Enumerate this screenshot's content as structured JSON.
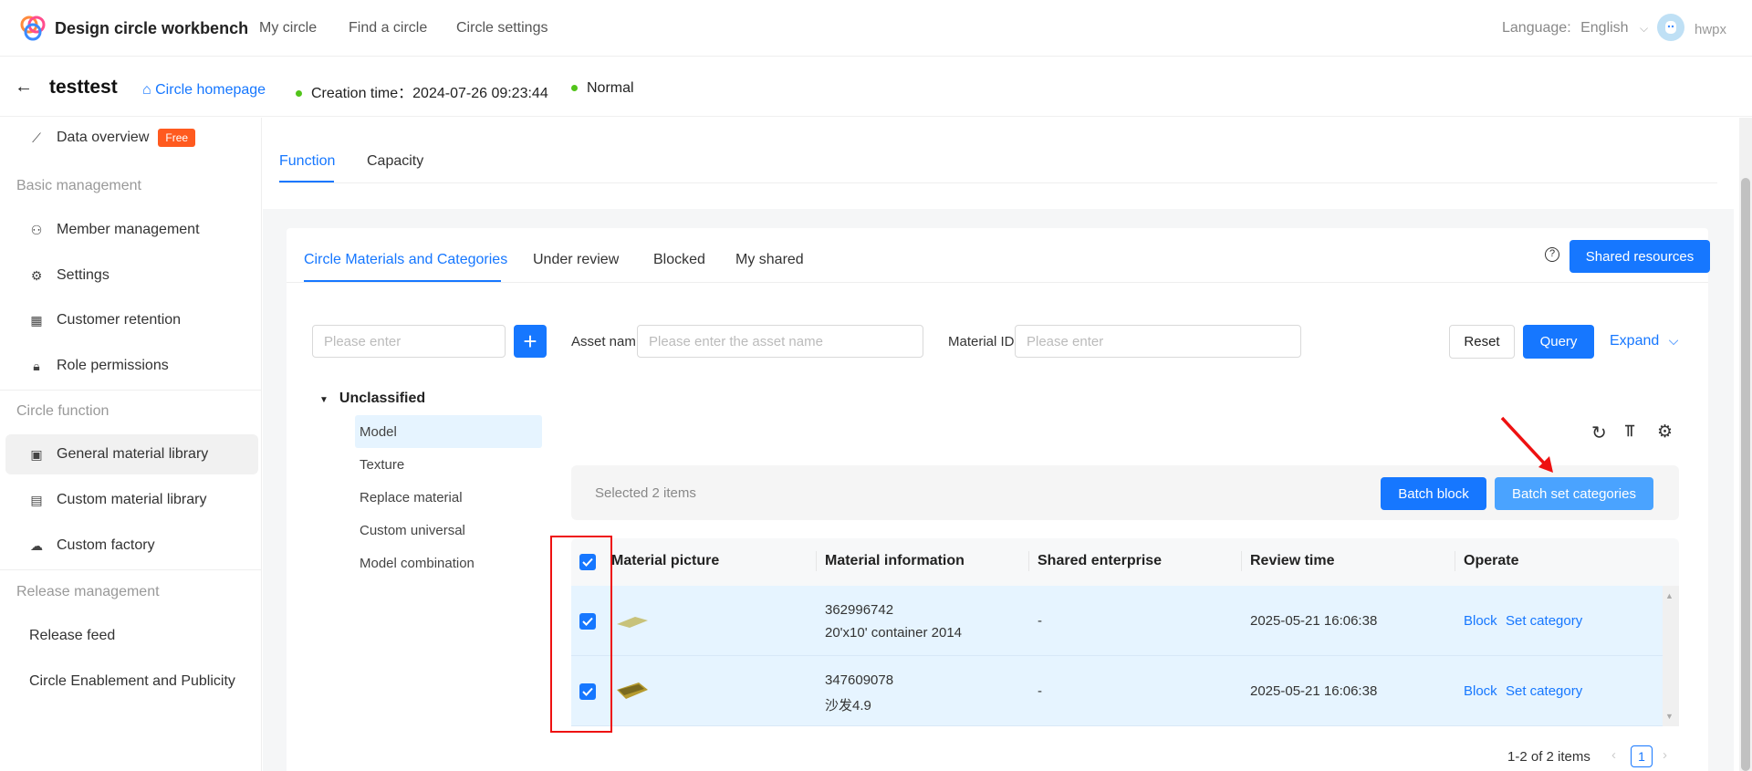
{
  "app": {
    "title": "Design circle workbench",
    "nav": [
      "My circle",
      "Find a circle",
      "Circle settings"
    ],
    "language_label": "Language:",
    "language_value": "English",
    "username": "hwpx"
  },
  "header": {
    "circle_name": "testtest",
    "home_link": "Circle homepage",
    "creation_time": "Creation time：2024-07-26 09:23:44",
    "status": "Normal"
  },
  "sidebar": {
    "data_overview": "Data overview",
    "free_badge": "Free",
    "groups": [
      "Basic management",
      "Circle function",
      "Release management"
    ],
    "basic": [
      "Member management",
      "Settings",
      "Customer retention",
      "Role permissions"
    ],
    "function": [
      "General material library",
      "Custom material library",
      "Custom factory"
    ],
    "release": [
      "Release feed",
      "Circle Enablement and Publicity"
    ]
  },
  "main": {
    "tabs": [
      "Function",
      "Capacity"
    ],
    "subtabs": [
      "Circle Materials and Categories",
      "Under review",
      "Blocked",
      "My shared"
    ],
    "shared_resources": "Shared resources",
    "filters": {
      "category_placeholder": "Please enter",
      "asset_label": "Asset nam",
      "asset_placeholder": "Please enter the asset name",
      "material_label": "Material ID",
      "material_placeholder": "Please enter",
      "reset": "Reset",
      "query": "Query",
      "expand": "Expand"
    },
    "tree": {
      "root": "Unclassified",
      "items": [
        "Model",
        "Texture",
        "Replace material",
        "Custom universal",
        "Model combination"
      ]
    },
    "bulk": {
      "selected": "Selected 2 items",
      "batch_block": "Batch block",
      "batch_set": "Batch set categories"
    },
    "table": {
      "headers": [
        "Material picture",
        "Material information",
        "Shared enterprise",
        "Review time",
        "Operate"
      ],
      "rows": [
        {
          "id": "362996742",
          "name": "20'x10' container 2014",
          "enterprise": "-",
          "time": "2025-05-21 16:06:38",
          "op1": "Block",
          "op2": "Set category"
        },
        {
          "id": "347609078",
          "name": "沙发4.9",
          "enterprise": "-",
          "time": "2025-05-21 16:06:38",
          "op1": "Block",
          "op2": "Set category"
        }
      ]
    },
    "pagination": {
      "summary": "1-2 of 2 items",
      "page": "1"
    }
  }
}
